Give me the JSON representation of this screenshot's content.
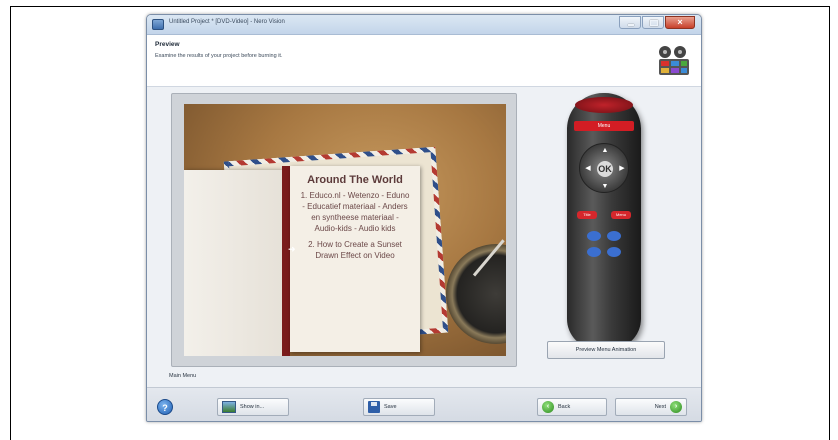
{
  "window": {
    "title": "Untitled Project * [DVD-Video] - Nero Vision",
    "close_glyph": "×"
  },
  "header": {
    "title": "Preview",
    "subtitle": "Examine the results of your project before burning it."
  },
  "preview": {
    "card_heading": "Around The World",
    "items": [
      "1. Educo.nl - Wetenzo - Eduno - Educatief materiaal - Anders en syntheese materiaal - Audio-kids - Audio kids",
      "2. How to Create a Sunset Drawn Effect on Video"
    ],
    "arrow": "➜"
  },
  "remote": {
    "label": "Menu",
    "dpad": {
      "up": "▲",
      "down": "▼",
      "left": "◀",
      "right": "▶",
      "center": "OK"
    },
    "buttons": {
      "top_left": "Title",
      "top_right": "Menu"
    }
  },
  "preview_animation_button": "Preview Menu Animation",
  "main_menu_label": "Main Menu",
  "bottom_bar": {
    "help": "?",
    "show_label": "Show in...",
    "save_label": "Save",
    "back_label": "Back",
    "next_label": "Next"
  },
  "colors": {
    "accent_red": "#d31d24",
    "accent_blue": "#3b6fd0",
    "go_green": "#2c8a1e"
  }
}
